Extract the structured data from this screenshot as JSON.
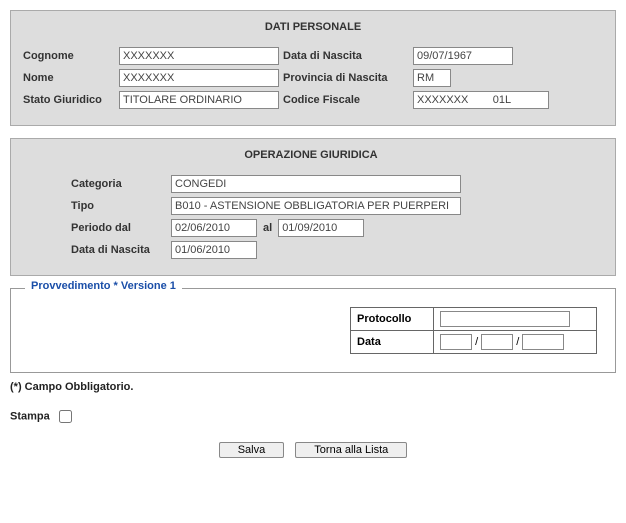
{
  "personal": {
    "title": "DATI PERSONALE",
    "labels": {
      "cognome": "Cognome",
      "nome": "Nome",
      "stato": "Stato Giuridico",
      "nascita": "Data di Nascita",
      "provincia": "Provincia di Nascita",
      "codfisc": "Codice Fiscale"
    },
    "values": {
      "cognome": "XXXXXXX",
      "nome": "XXXXXXX",
      "stato": "TITOLARE ORDINARIO",
      "nascita": "09/07/1967",
      "provincia": "RM",
      "codfisc": "XXXXXXX        01L"
    }
  },
  "operation": {
    "title": "OPERAZIONE GIURIDICA",
    "labels": {
      "categoria": "Categoria",
      "tipo": "Tipo",
      "periodo_dal": "Periodo dal",
      "al": "al",
      "nascita": "Data di Nascita"
    },
    "values": {
      "categoria": "CONGEDI",
      "tipo": "B010 - ASTENSIONE OBBLIGATORIA PER PUERPERI",
      "periodo_dal": "02/06/2010",
      "periodo_al": "01/09/2010",
      "nascita": "01/06/2010"
    }
  },
  "provv": {
    "legend": "Provvedimento * Versione 1",
    "labels": {
      "protocollo": "Protocollo",
      "data": "Data"
    },
    "sep": "/"
  },
  "footer": {
    "mandatory": "(*) Campo Obbligatorio.",
    "stampa": "Stampa",
    "save": "Salva",
    "back": "Torna alla Lista"
  }
}
